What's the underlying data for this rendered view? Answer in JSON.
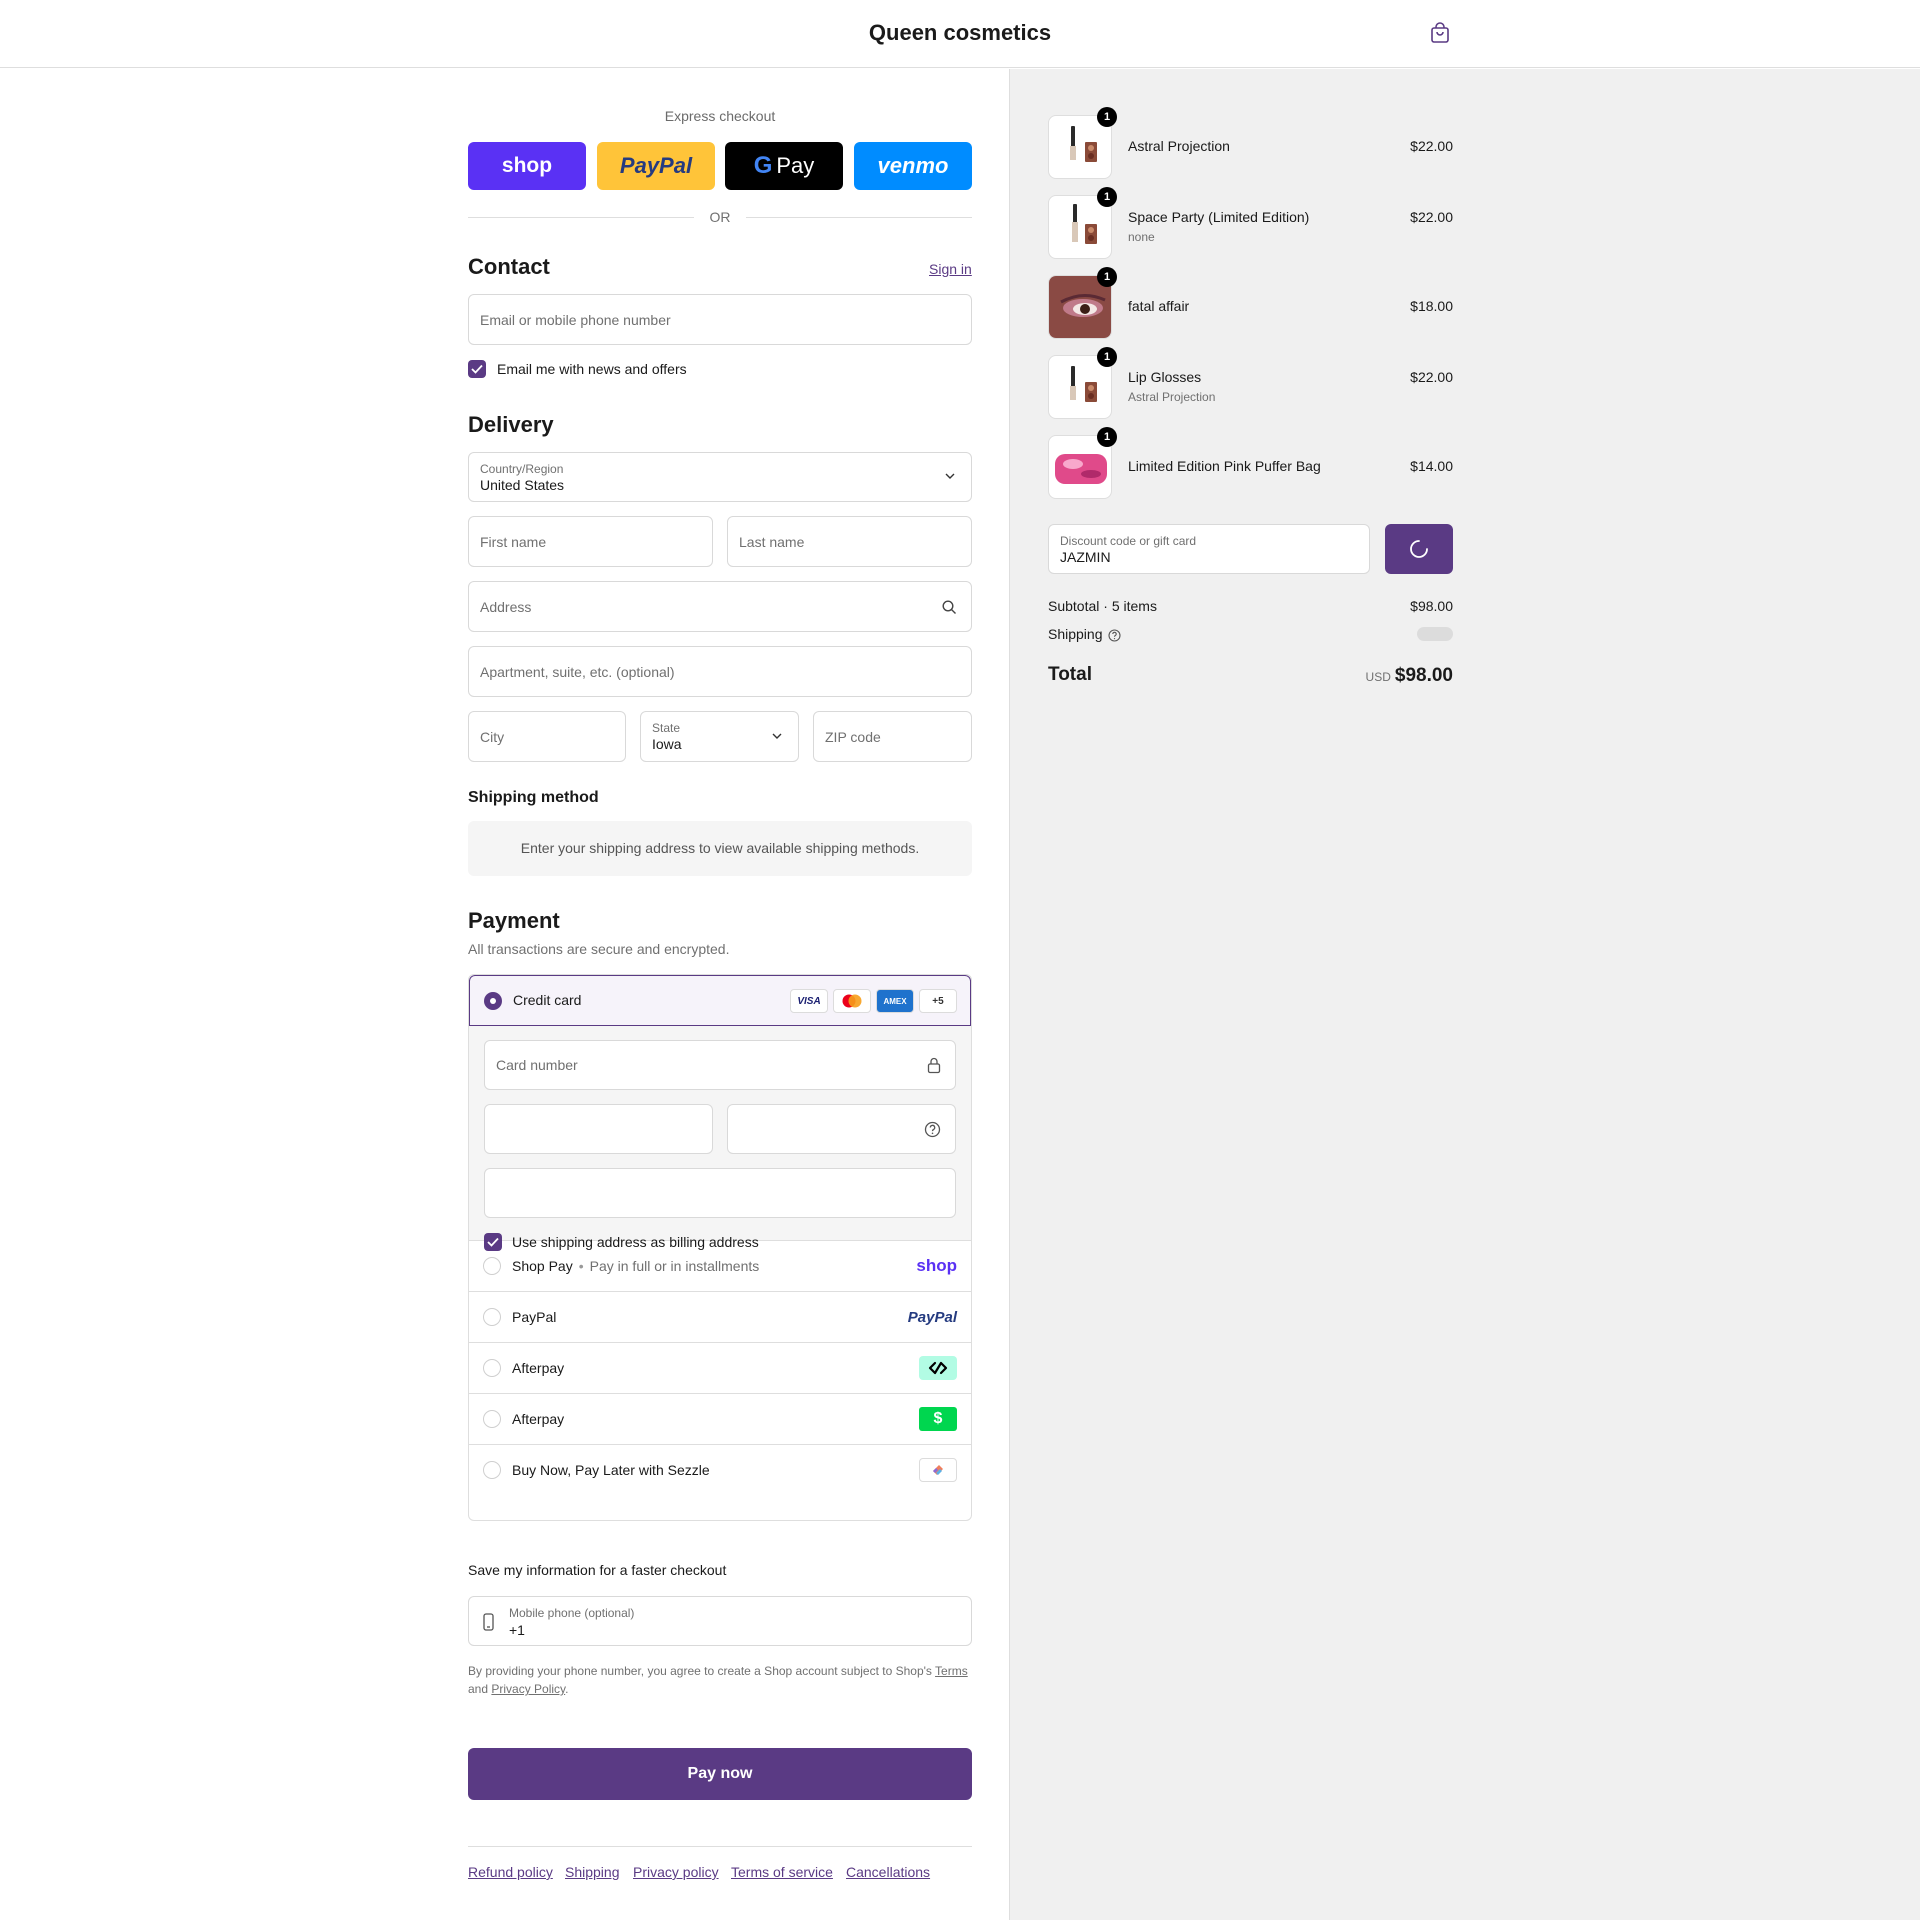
{
  "header": {
    "brand": "Queen cosmetics"
  },
  "express": {
    "label": "Express checkout",
    "buttons": [
      "shop",
      "PayPal",
      "Pay",
      "venmo"
    ],
    "or_label": "OR"
  },
  "contact": {
    "title": "Contact",
    "sign_in": "Sign in",
    "email_placeholder": "Email or mobile phone number",
    "newsletter_label": "Email me with news and offers"
  },
  "delivery": {
    "title": "Delivery",
    "country_label": "Country/Region",
    "country_value": "United States",
    "first_name": "First name",
    "last_name": "Last name",
    "address": "Address",
    "apartment": "Apartment, suite, etc. (optional)",
    "city": "City",
    "state_label": "State",
    "state_value": "Iowa",
    "zip": "ZIP code"
  },
  "shipping_method": {
    "title": "Shipping method",
    "notice": "Enter your shipping address to view available shipping methods."
  },
  "payment": {
    "title": "Payment",
    "subtitle": "All transactions are secure and encrypted.",
    "credit_card_label": "Credit card",
    "card_badges": [
      "VISA",
      "AMEX",
      "+5"
    ],
    "card_number": "Card number",
    "billing_label": "Use shipping address as billing address",
    "methods": [
      {
        "label": "Shop Pay",
        "extra": "Pay in full or in installments",
        "logo": "shop"
      },
      {
        "label": "PayPal",
        "logo": "PayPal"
      },
      {
        "label": "Afterpay",
        "logo": "afterpay-icon"
      },
      {
        "label": "Afterpay",
        "logo": "$"
      },
      {
        "label": "Buy Now, Pay Later with Sezzle",
        "logo": "sezzle-icon"
      }
    ]
  },
  "save_info": {
    "title": "Save my information for a faster checkout",
    "phone_label": "Mobile phone (optional)",
    "phone_value": "+1",
    "legal_pre": "By providing your phone number, you agree to create a Shop account subject to Shop's",
    "legal_terms": "Terms",
    "legal_and": "and",
    "legal_privacy": "Privacy Policy",
    "legal_end": "."
  },
  "pay_now": "Pay now",
  "footer": [
    "Refund policy",
    "Shipping",
    "Privacy policy",
    "Terms of service",
    "Cancellations"
  ],
  "cart": {
    "items": [
      {
        "name": "Astral Projection",
        "variant": "",
        "price": "$22.00",
        "qty": "1"
      },
      {
        "name": "Space Party (Limited Edition)",
        "variant": "none",
        "price": "$22.00",
        "qty": "1"
      },
      {
        "name": "fatal affair",
        "variant": "",
        "price": "$18.00",
        "qty": "1"
      },
      {
        "name": "Lip Glosses",
        "variant": "Astral Projection",
        "price": "$22.00",
        "qty": "1"
      },
      {
        "name": "Limited Edition Pink Puffer Bag",
        "variant": "",
        "price": "$14.00",
        "qty": "1"
      }
    ],
    "discount_label": "Discount code or gift card",
    "discount_value": "JAZMIN",
    "subtotal_label": "Subtotal · 5 items",
    "subtotal_value": "$98.00",
    "shipping_label": "Shipping",
    "total_label": "Total",
    "currency": "USD",
    "total_value": "$98.00"
  },
  "colors": {
    "accent": "#5a3a84",
    "shop": "#5a31f4",
    "paypal": "#ffc439",
    "venmo": "#008cff"
  }
}
